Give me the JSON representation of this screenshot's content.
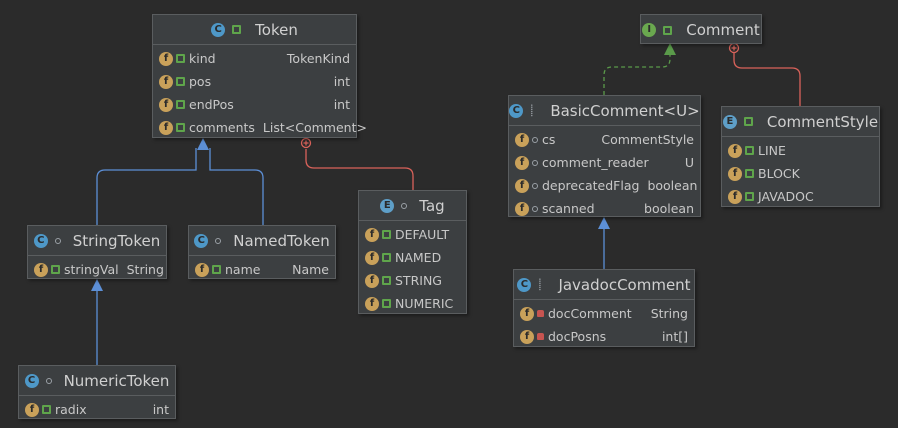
{
  "classes": {
    "token": {
      "name": "Token",
      "fields": [
        {
          "name": "kind",
          "type": "TokenKind"
        },
        {
          "name": "pos",
          "type": "int"
        },
        {
          "name": "endPos",
          "type": "int"
        },
        {
          "name": "comments",
          "type": "List<Comment>"
        }
      ]
    },
    "string_token": {
      "name": "StringToken",
      "fields": [
        {
          "name": "stringVal",
          "type": "String"
        }
      ]
    },
    "named_token": {
      "name": "NamedToken",
      "fields": [
        {
          "name": "name",
          "type": "Name"
        }
      ]
    },
    "numeric_token": {
      "name": "NumericToken",
      "fields": [
        {
          "name": "radix",
          "type": "int"
        }
      ]
    },
    "tag": {
      "name": "Tag",
      "constants": [
        "DEFAULT",
        "NAMED",
        "STRING",
        "NUMERIC"
      ]
    },
    "comment": {
      "name": "Comment"
    },
    "basic_comment": {
      "name": "BasicComment<U>",
      "fields": [
        {
          "name": "cs",
          "type": "CommentStyle"
        },
        {
          "name": "comment_reader",
          "type": "U"
        },
        {
          "name": "deprecatedFlag",
          "type": "boolean"
        },
        {
          "name": "scanned",
          "type": "boolean"
        }
      ]
    },
    "javadoc_comment": {
      "name": "JavadocComment",
      "fields": [
        {
          "name": "docComment",
          "type": "String"
        },
        {
          "name": "docPosns",
          "type": "int[]"
        }
      ]
    },
    "comment_style": {
      "name": "CommentStyle",
      "constants": [
        "LINE",
        "BLOCK",
        "JAVADOC"
      ]
    }
  },
  "icons": {
    "class": "C",
    "field": "f",
    "enum": "E",
    "interface": "I"
  },
  "colors": {
    "background": "#2b2b2b",
    "node_fill": "#3c3f41",
    "inheritance_edge": "#5c8fd6",
    "inner_class_edge": "#d9625a",
    "implements_edge": "#5a9a4a"
  }
}
